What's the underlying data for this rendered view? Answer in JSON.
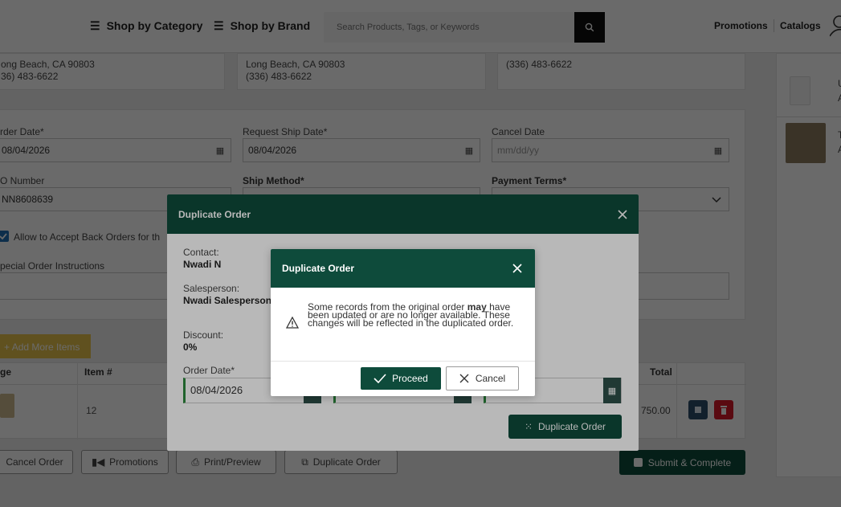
{
  "header": {
    "shop_category": "Shop by Category",
    "shop_brand": "Shop by Brand",
    "search_placeholder": "Search Products, Tags, or Keywords",
    "promotions": "Promotions",
    "catalogs": "Catalogs"
  },
  "addresses": {
    "a1_line1": "ong Beach, CA 90803",
    "a1_phone": "36) 483-6622",
    "a2_line1": "Long Beach, CA 90803",
    "a2_phone": "(336) 483-6622",
    "a3_phone": "(336) 483-6622"
  },
  "form": {
    "order_date_label": "rder Date*",
    "order_date_value": "08/04/2026",
    "request_ship_label": "Request Ship Date*",
    "request_ship_value": "08/04/2026",
    "cancel_date_label": "Cancel Date",
    "cancel_date_placeholder": "mm/dd/yy",
    "po_label": "O Number",
    "po_value": "NN8608639",
    "ship_method_label": "Ship Method*",
    "payment_terms_label": "Payment Terms*",
    "back_orders_label": "Allow to Accept Back Orders for th",
    "special_instructions_label": "pecial Order Instructions",
    "add_more_items": "Add More Items",
    "col_image": "ge",
    "col_item": "Item #",
    "col_total": "Total",
    "row_item": "12",
    "row_total": "750.00"
  },
  "bottom_buttons": {
    "cancel_order": "Cancel Order",
    "promotions": "Promotions",
    "print_preview": "Print/Preview",
    "duplicate_order": "Duplicate Order",
    "submit_complete": "Submit & Complete"
  },
  "sidebar": {
    "item1_a": "U",
    "item1_b": "A",
    "item2_a": "T",
    "item2_b": "A"
  },
  "modal_outer": {
    "title": "Duplicate Order",
    "contact_label": "Contact:",
    "contact_value": "Nwadi N",
    "salesperson_label": "Salesperson:",
    "salesperson_value": "Nwadi Salesperson",
    "discount_label": "Discount:",
    "discount_value": "0%",
    "order_date_label": "Order Date*",
    "order_date_value": "08/04/2026",
    "duplicate_button": "Duplicate Order"
  },
  "modal_inner": {
    "title": "Duplicate Order",
    "message_pre": "Some records from the original order ",
    "message_bold": "may",
    "message_post": " have been updated or are no longer available. These changes will be reflected in the duplicated order.",
    "proceed": "Proceed",
    "cancel": "Cancel"
  },
  "colors": {
    "brand_green": "#0e4b3b",
    "accent_gold": "#e6c34a",
    "danger_red": "#d7192a"
  }
}
